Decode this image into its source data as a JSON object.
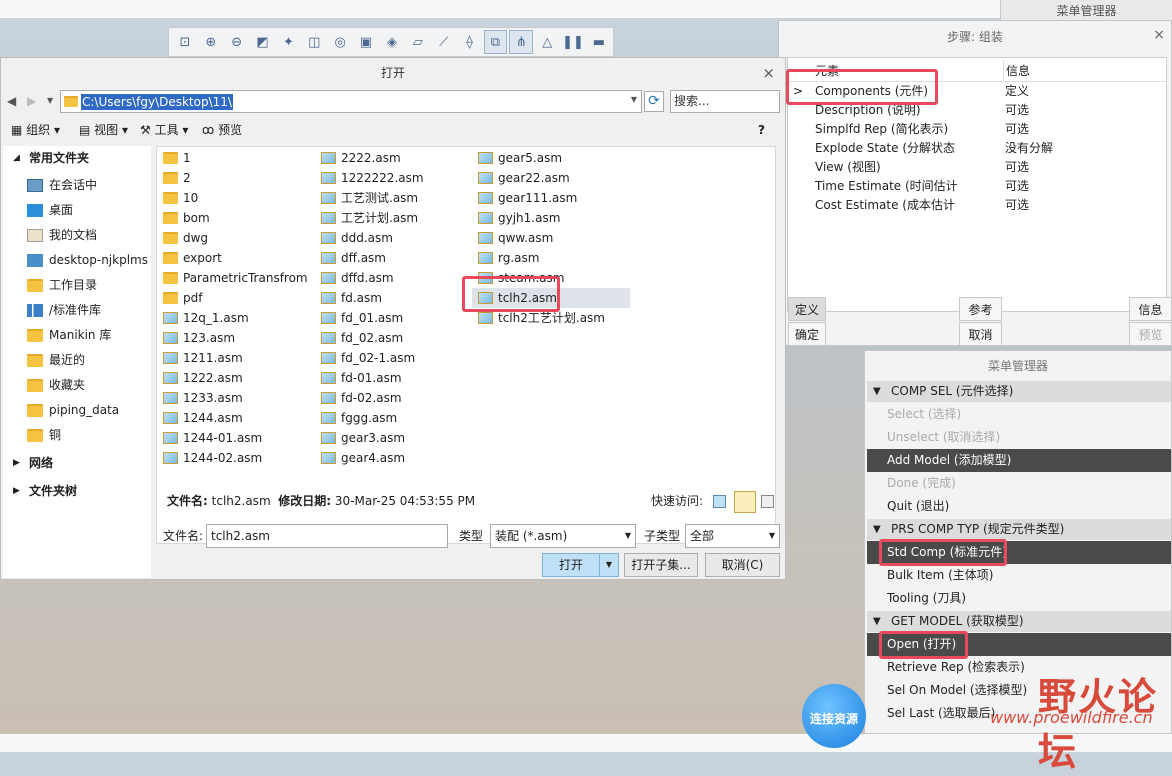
{
  "toolbar": {
    "icons": [
      "zoom-fit-icon",
      "zoom-in-icon",
      "zoom-out-icon",
      "repaint-icon",
      "spin-icon",
      "view-box-icon",
      "saved-views-icon",
      "screenshot-icon",
      "shade-icon",
      "datum-planes-icon",
      "datum-axes-icon",
      "annotation-icon",
      "component-display-icon",
      "model-tree-icon",
      "warning-icon",
      "pause-icon",
      "stop-icon"
    ]
  },
  "menu_manager_top": {
    "title": "菜单管理器"
  },
  "step_dialog": {
    "title": "步骤: 组装",
    "close": "×",
    "header": {
      "col1": "元素",
      "col2": "信息"
    },
    "rows": [
      {
        "arrow": ">",
        "element": "Components (元件)",
        "info": "定义"
      },
      {
        "arrow": "",
        "element": "Description (说明)",
        "info": "可选"
      },
      {
        "arrow": "",
        "element": "Simplfd Rep (简化表示)",
        "info": "可选"
      },
      {
        "arrow": "",
        "element": "Explode State (分解状态",
        "info": "没有分解"
      },
      {
        "arrow": "",
        "element": "View (视图)",
        "info": "可选"
      },
      {
        "arrow": "",
        "element": "Time Estimate (时间估计",
        "info": "可选"
      },
      {
        "arrow": "",
        "element": "Cost Estimate (成本估计",
        "info": "可选"
      }
    ],
    "buttons": {
      "define": "定义",
      "refs": "参考",
      "info": "信息",
      "ok": "确定",
      "cancel": "取消",
      "preview": "预览"
    }
  },
  "menu_manager": {
    "title": "菜单管理器",
    "sections": [
      {
        "label": "COMP SEL (元件选择)",
        "items": [
          {
            "label": "Select (选择)",
            "state": "disabled"
          },
          {
            "label": "Unselect (取消选择)",
            "state": "disabled"
          },
          {
            "label": "Add Model (添加模型)",
            "state": "selected"
          },
          {
            "label": "Done (完成)",
            "state": "disabled"
          },
          {
            "label": "Quit (退出)",
            "state": "normal"
          }
        ]
      },
      {
        "label": "PRS COMP TYP (规定元件类型)",
        "items": [
          {
            "label": "Std Comp (标准元件)",
            "state": "selected"
          },
          {
            "label": "Bulk Item (主体项)",
            "state": "normal"
          },
          {
            "label": "Tooling (刀具)",
            "state": "normal"
          }
        ]
      },
      {
        "label": "GET MODEL (获取模型)",
        "items": [
          {
            "label": "Open (打开)",
            "state": "selected"
          },
          {
            "label": "Retrieve Rep (检索表示)",
            "state": "normal"
          },
          {
            "label": "Sel On Model (选择模型)",
            "state": "normal"
          },
          {
            "label": "Sel Last (选取最后)",
            "state": "normal"
          }
        ]
      }
    ]
  },
  "file_dialog": {
    "title": "打开",
    "close": "×",
    "path": "C:\\Users\\fgy\\Desktop\\11\\",
    "search_placeholder": "搜索...",
    "toolbar": {
      "organize": "组织",
      "view": "视图",
      "tools": "工具",
      "preview": "预览",
      "help": "?"
    },
    "sidebar": {
      "favorites": "常用文件夹",
      "items": [
        "在会话中",
        "桌面",
        "我的文档",
        "desktop-njkplms",
        "工作目录",
        "/标准件库",
        "Manikin 库",
        "最近的",
        "收藏夹",
        "piping_data",
        "铜"
      ],
      "network": "网络",
      "folder_tree": "文件夹树"
    },
    "files": {
      "col1": [
        "1",
        "2",
        "10",
        "bom",
        "dwg",
        "export",
        "ParametricTransfrom",
        "pdf",
        "12q_1.asm",
        "123.asm",
        "1211.asm",
        "1222.asm",
        "1233.asm",
        "1244.asm",
        "1244-01.asm",
        "1244-02.asm"
      ],
      "col1_folder_count": 8,
      "col2": [
        "2222.asm",
        "1222222.asm",
        "工艺测试.asm",
        "工艺计划.asm",
        "ddd.asm",
        "dff.asm",
        "dffd.asm",
        "fd.asm",
        "fd_01.asm",
        "fd_02.asm",
        "fd_02-1.asm",
        "fd-01.asm",
        "fd-02.asm",
        "fggg.asm",
        "gear3.asm",
        "gear4.asm"
      ],
      "col3": [
        "gear5.asm",
        "gear22.asm",
        "gear111.asm",
        "gyjh1.asm",
        "qww.asm",
        "rg.asm",
        "steam.asm",
        "tclh2.asm",
        "tclh2工艺计划.asm"
      ],
      "selected": "tclh2.asm"
    },
    "info": {
      "name_label": "文件名:",
      "name": "tclh2.asm",
      "date_label": "修改日期:",
      "date": "30-Mar-25 04:53:55 PM",
      "quick": "快速访问:"
    },
    "filename_label": "文件名:",
    "filename_value": "tclh2.asm",
    "type_label": "类型",
    "type_value": "装配 (*.asm)",
    "subtype_label": "子类型",
    "subtype_value": "全部",
    "buttons": {
      "open": "打开",
      "open_sub": "打开子集...",
      "cancel": "取消(C)"
    }
  },
  "chat_button": "连接资源",
  "watermark": {
    "text": "野火论坛",
    "url": "www.proewildfire.cn"
  },
  "colors": {
    "highlight": "#e8495d",
    "selected_menu": "#4a4a4a",
    "primary_btn": "#bfe0f7"
  }
}
